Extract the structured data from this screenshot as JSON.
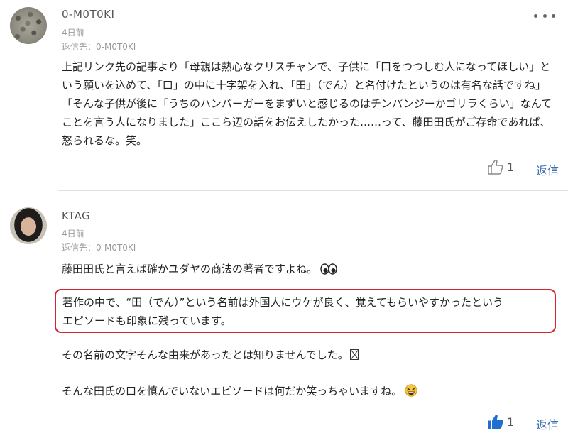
{
  "comments": [
    {
      "username": "0-M0T0KI",
      "time": "4日前",
      "reply_to": "返信先：0-M0T0KI",
      "text": "上記リンク先の記事より「母親は熱心なクリスチャンで、子供に「口をつつしむ人になってほしい」という願いを込めて、「口」の中に十字架を入れ、「田」（でん）と名付けたというのは有名な話ですね」「そんな子供が後に「うちのハンバーガーをまずいと感じるのはチンパンジーかゴリラくらい」なんてことを言う人になりました」ここら辺の話をお伝えしたかった……って、藤田田氏がご存命であれば、怒られるな。笑。",
      "likes": "1",
      "reply_label": "返信",
      "avatar_icon": "pebbles-avatar"
    },
    {
      "username": "KTAG",
      "time": "4日前",
      "reply_to": "返信先：0-M0T0KI",
      "para1": "藤田田氏と言えば確かユダヤの商法の著者ですよね。",
      "highlight_line1": "著作の中で、“田（でん）”という名前は外国人にウケが良く、覚えてもらいやすかったという",
      "highlight_line2": "エピソードも印象に残っています。",
      "para3": "その名前の文字そんな由来があったとは知りませんでした。",
      "para4": "そんな田氏の口を慎んでいないエピソードは何だか笑っちゃいますね。",
      "likes": "1",
      "reply_label": "返信",
      "avatar_icon": "person-avatar"
    }
  ],
  "colors": {
    "highlight_border": "#d7242f",
    "reply_link": "#3b6fb0",
    "like_active": "#1f6fd1",
    "like_inactive": "#888888"
  }
}
